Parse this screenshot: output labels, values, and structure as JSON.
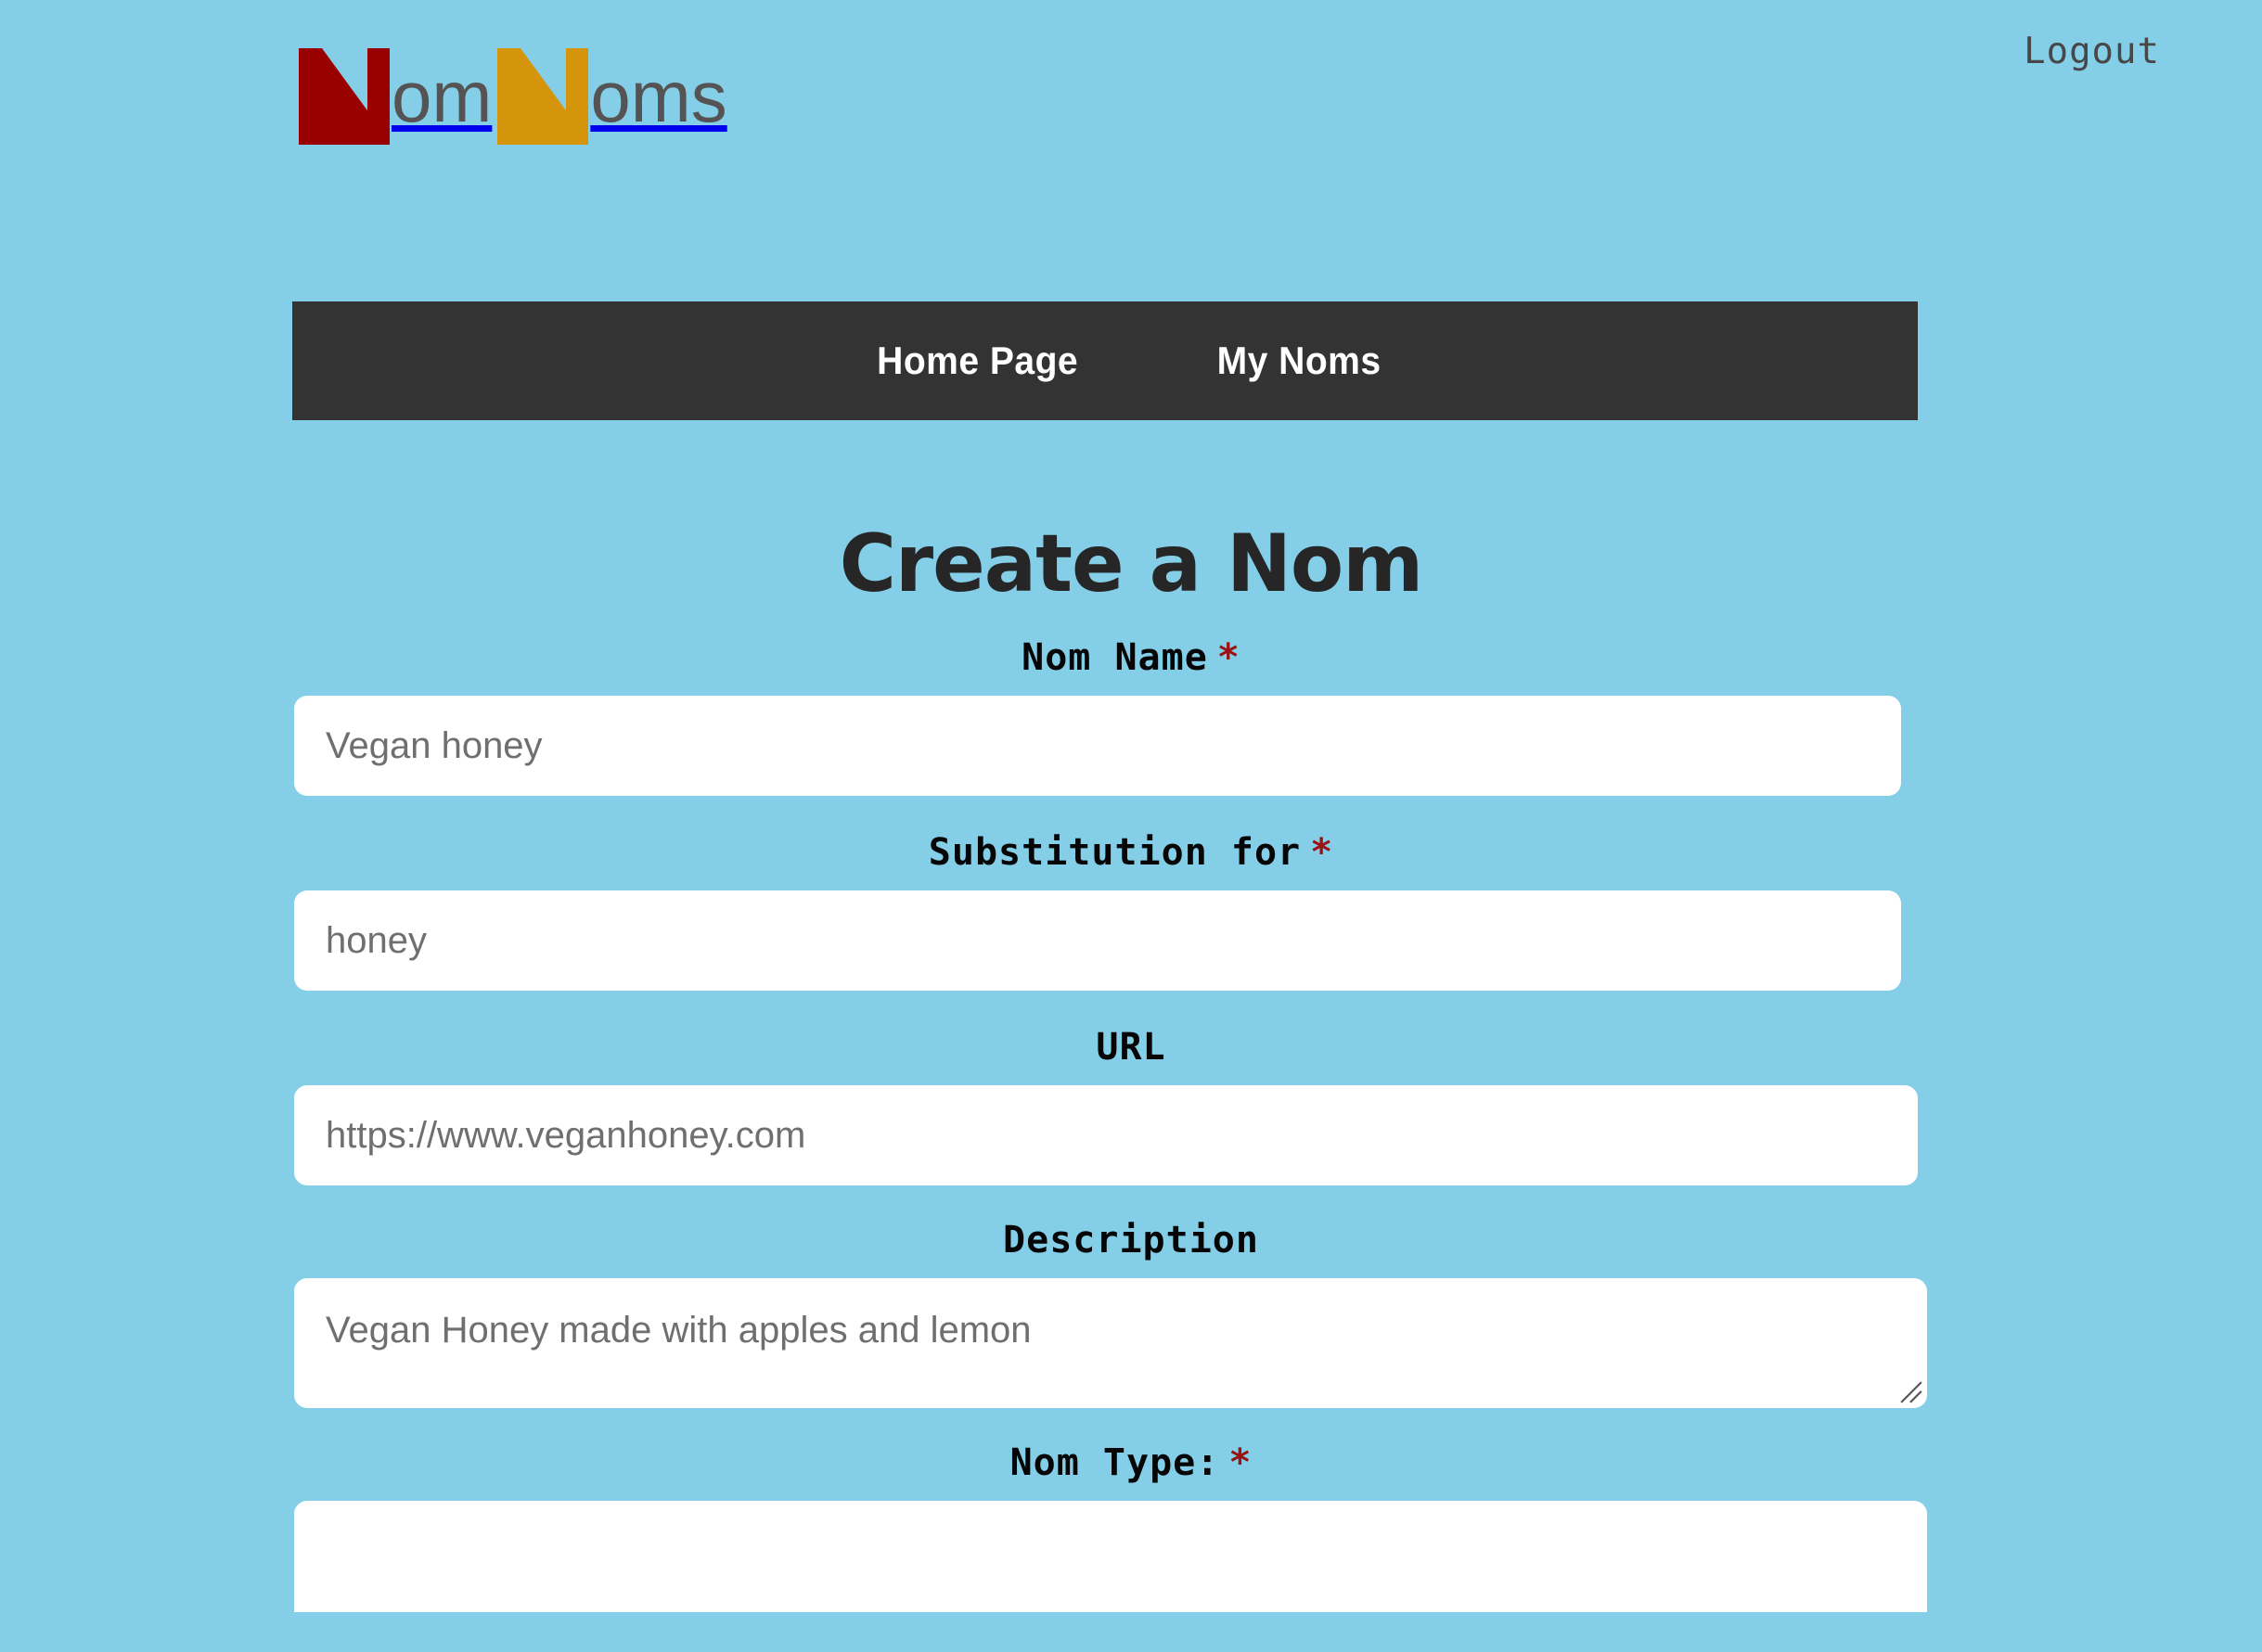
{
  "brand": {
    "logo_part_1": "om",
    "logo_part_2": "oms",
    "logo_letter_1": "N",
    "logo_letter_2": "N",
    "full_name": "NomNoms",
    "color_n1": "#990000",
    "color_n2": "#d4940c",
    "color_word": "#555353"
  },
  "header": {
    "logout_label": "Logout"
  },
  "nav": {
    "items": [
      {
        "label": "Home Page",
        "name": "nav-home-page"
      },
      {
        "label": "My Noms",
        "name": "nav-my-noms"
      }
    ],
    "background": "#333333"
  },
  "page": {
    "title": "Create a Nom",
    "background": "#84cee8"
  },
  "form": {
    "required_marker": "*",
    "fields": [
      {
        "label": "Nom Name",
        "required": true,
        "type": "text",
        "value": "",
        "placeholder": "Vegan honey"
      },
      {
        "label": "Substitution for",
        "required": true,
        "type": "text",
        "value": "",
        "placeholder": "honey"
      },
      {
        "label": "URL",
        "required": false,
        "type": "url",
        "value": "",
        "placeholder": "https://www.veganhoney.com"
      },
      {
        "label": "Description",
        "required": false,
        "type": "textarea",
        "value": "",
        "placeholder": "Vegan Honey made with apples and lemon"
      },
      {
        "label": "Nom Type:",
        "required": true,
        "type": "select",
        "value": "",
        "placeholder": ""
      }
    ]
  }
}
